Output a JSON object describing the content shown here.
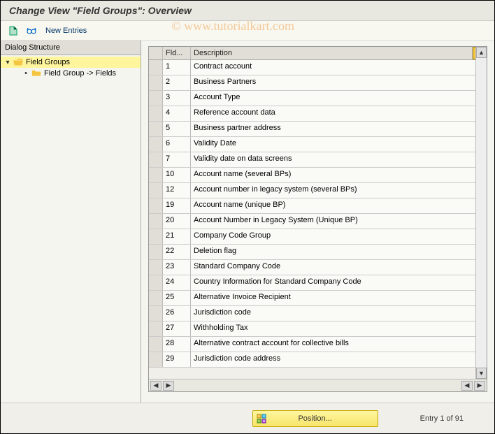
{
  "title": "Change View \"Field Groups\": Overview",
  "toolbar": {
    "new_entries_label": "New Entries"
  },
  "sidebar": {
    "header": "Dialog Structure",
    "root": {
      "label": "Field Groups"
    },
    "child": {
      "label": "Field Group -> Fields"
    }
  },
  "table": {
    "col_fld_header": "Fld...",
    "col_desc_header": "Description",
    "rows": [
      {
        "fld": "1",
        "desc": "Contract account"
      },
      {
        "fld": "2",
        "desc": "Business Partners"
      },
      {
        "fld": "3",
        "desc": "Account Type"
      },
      {
        "fld": "4",
        "desc": "Reference account data"
      },
      {
        "fld": "5",
        "desc": "Business partner address"
      },
      {
        "fld": "6",
        "desc": "Validity Date"
      },
      {
        "fld": "7",
        "desc": "Validity date on data screens"
      },
      {
        "fld": "10",
        "desc": "Account name (several BPs)"
      },
      {
        "fld": "12",
        "desc": "Account number in legacy system (several BPs)"
      },
      {
        "fld": "19",
        "desc": "Account name (unique BP)"
      },
      {
        "fld": "20",
        "desc": "Account Number in Legacy System (Unique BP)"
      },
      {
        "fld": "21",
        "desc": "Company Code Group"
      },
      {
        "fld": "22",
        "desc": "Deletion flag"
      },
      {
        "fld": "23",
        "desc": "Standard Company Code"
      },
      {
        "fld": "24",
        "desc": "Country Information for Standard Company Code"
      },
      {
        "fld": "25",
        "desc": "Alternative Invoice Recipient"
      },
      {
        "fld": "26",
        "desc": "Jurisdiction code"
      },
      {
        "fld": "27",
        "desc": "Withholding Tax"
      },
      {
        "fld": "28",
        "desc": "Alternative contract account for collective bills"
      },
      {
        "fld": "29",
        "desc": "Jurisdiction code address"
      }
    ]
  },
  "footer": {
    "position_label": "Position...",
    "entry_status": "Entry 1 of 91"
  },
  "watermark": "© www.tutorialkart.com"
}
